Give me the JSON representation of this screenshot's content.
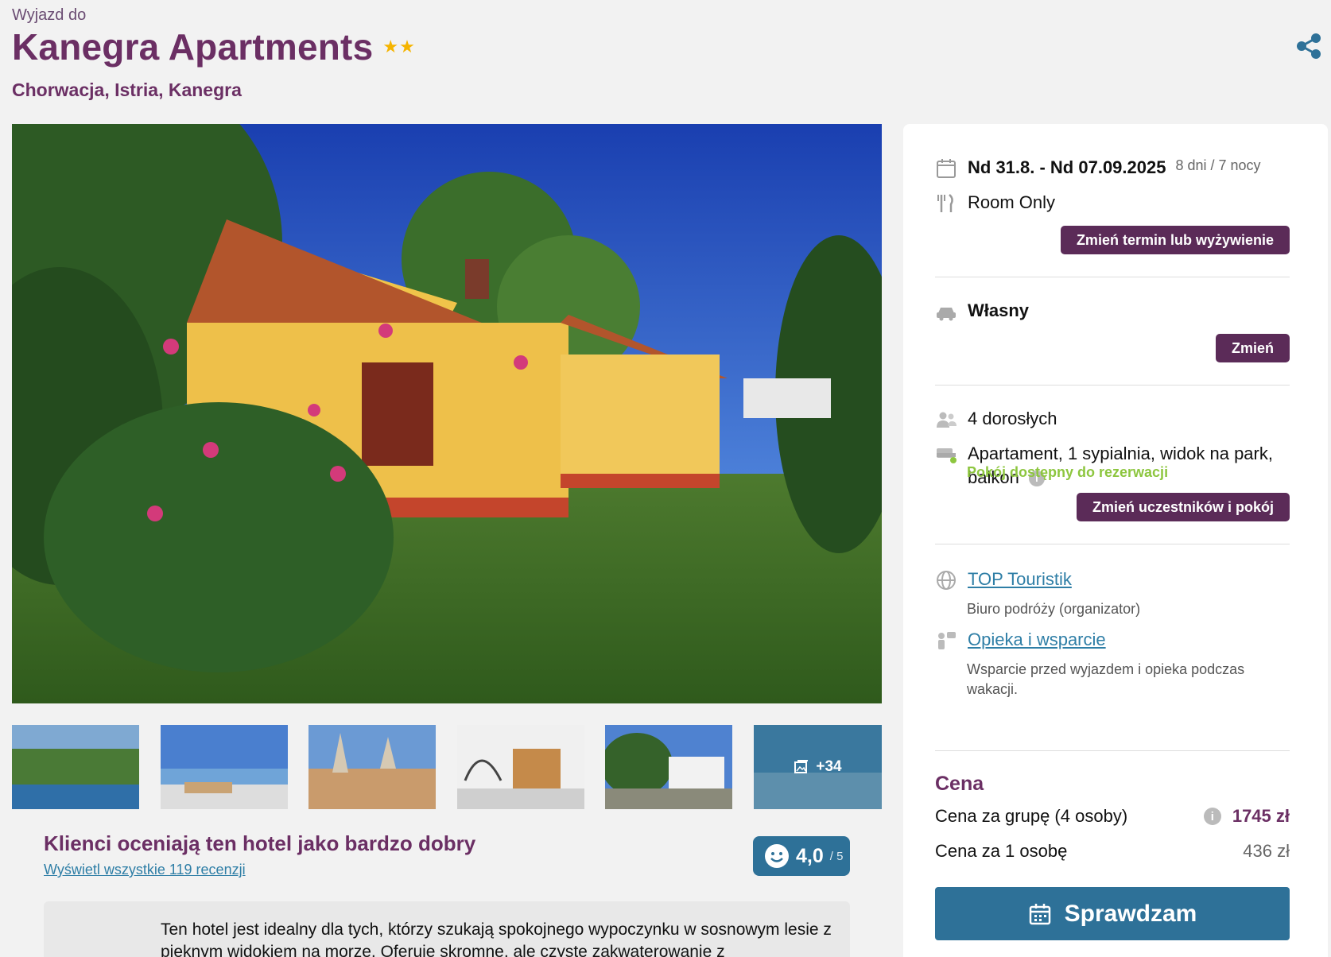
{
  "header": {
    "pre_title": "Wyjazd do",
    "title": "Kanegra Apartments",
    "stars": "★★",
    "location": "Chorwacja, Istria, Kanegra",
    "share_icon": "share-icon"
  },
  "gallery": {
    "more_label": "+34"
  },
  "reviews": {
    "headline": "Klienci oceniają ten hotel jako bardzo dobry",
    "link": "Wyświetl wszystkie 119 recenzji",
    "score": "4,0",
    "score_max": "/ 5"
  },
  "description": {
    "text": "Ten hotel jest idealny dla tych, którzy szukają spokojnego wypoczynku w sosnowym lesie z pięknym widokiem na morze. Oferuje skromne, ale czyste zakwaterowanie z"
  },
  "booking": {
    "dates": "Nd 31.8. - Nd 07.09.2025",
    "duration": "8 dni / 7 nocy",
    "board": "Room Only",
    "change_term_button": "Zmień termin lub wyżywienie",
    "transport": "Własny",
    "change_transport_button": "Zmień",
    "guests": "4 dorosłych",
    "room": "Apartament, 1 sypialnia, widok na park, balkon",
    "room_status": "Pokój dostępny do rezerwacji",
    "change_room_button": "Zmień uczestników i pokój",
    "organizer_link": "TOP Touristik",
    "organizer_sub": "Biuro podróży (organizator)",
    "support_link": "Opieka i wsparcie",
    "support_sub": "Wsparcie przed wyjazdem i opieka podczas wakacji."
  },
  "price": {
    "heading": "Cena",
    "group_label": "Cena za grupę (4 osoby)",
    "group_value": "1745 zł",
    "person_label": "Cena za 1 osobę",
    "person_value": "436 zł",
    "cta": "Sprawdzam"
  },
  "colors": {
    "brand": "#6b2f64",
    "button": "#5b2b58",
    "accent": "#2e7198",
    "available": "#8dc63f"
  }
}
